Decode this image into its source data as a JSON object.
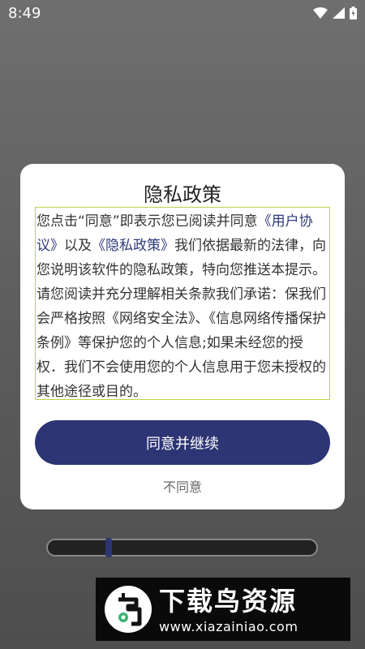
{
  "status_bar": {
    "time": "8:49"
  },
  "dialog": {
    "title": "隐私政策",
    "body": {
      "seg1": "您点击“同意”即表示您已阅读并同意",
      "link_user_agreement": "《用户协议》",
      "seg2": "以及",
      "link_privacy_policy": "《隐私政策》",
      "seg3": "我们依据最新的法律，向您说明该软件的隐私政策，特向您推送本提示。请您阅读并充分理解相关条款我们承诺：保我们会严格按照《网络安全法》、《信息网络传播保护条例》等保护您的个人信息;如果未经您的授权．我们不会使用您的个人信息用于您未授权的其他途径或目的。"
    },
    "agree_label": "同意并继续",
    "disagree_label": "不同意"
  },
  "progress": {
    "fraction": 0.22
  },
  "watermark": {
    "title": "下载鸟资源",
    "url": "www.xiazainiao.com"
  },
  "colors": {
    "accent": "#2d3575",
    "border_highlight": "#b6d64a"
  }
}
